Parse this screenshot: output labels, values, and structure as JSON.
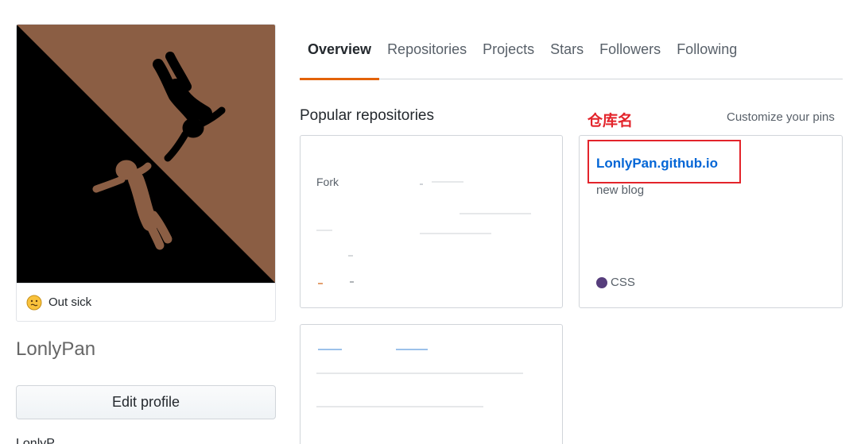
{
  "profile": {
    "status_text": "Out sick",
    "name": "LonlyPan",
    "edit_label": "Edit profile",
    "cutoff_text": "LonlyP..",
    "avatar_colors": {
      "brown": "#8b5e44",
      "black": "#000000"
    }
  },
  "tabs": [
    {
      "label": "Overview"
    },
    {
      "label": "Repositories"
    },
    {
      "label": "Projects"
    },
    {
      "label": "Stars"
    },
    {
      "label": "Followers"
    },
    {
      "label": "Following"
    }
  ],
  "main": {
    "section_title": "Popular repositories",
    "annotation": "仓库名",
    "customize_label": "Customize your pins"
  },
  "cards": {
    "card1": {
      "fork_text": "Fork"
    },
    "card2": {
      "repo_name": "LonlyPan.github.io",
      "description": "new blog",
      "language": "CSS",
      "language_color": "#563d7c"
    }
  },
  "accent_color": "#e36209",
  "highlight_color": "#e3242b"
}
